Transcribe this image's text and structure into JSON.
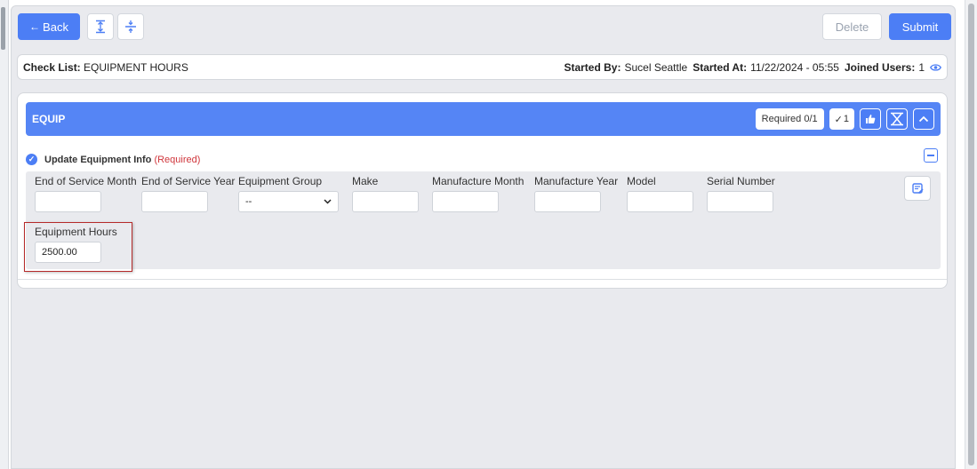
{
  "toolbar": {
    "back_label": "Back",
    "delete_label": "Delete",
    "submit_label": "Submit"
  },
  "checklist": {
    "label": "Check List:",
    "name": "EQUIPMENT HOURS",
    "started_by_label": "Started By:",
    "started_by": "Sucel Seattle",
    "started_at_label": "Started At:",
    "started_at": "11/22/2024 - 05:55",
    "joined_users_label": "Joined Users:",
    "joined_users": "1"
  },
  "section": {
    "title": "EQUIP",
    "required_badge": "Required 0/1",
    "check_count": "1"
  },
  "task": {
    "title": "Update Equipment Info",
    "required_text": "(Required)"
  },
  "fields": [
    {
      "label": "End of Service Month",
      "value": ""
    },
    {
      "label": "End of Service Year",
      "value": ""
    },
    {
      "label": "Equipment Group",
      "value": "--"
    },
    {
      "label": "Make",
      "value": ""
    },
    {
      "label": "Manufacture Month",
      "value": ""
    },
    {
      "label": "Manufacture Year",
      "value": ""
    },
    {
      "label": "Model",
      "value": ""
    },
    {
      "label": "Serial Number",
      "value": ""
    },
    {
      "label": "Equipment Hours",
      "value": "2500.00"
    }
  ],
  "colors": {
    "primary": "#4c7ef5",
    "section_header": "#5585f5",
    "required": "#d0363c",
    "highlight": "#b52a2a"
  }
}
